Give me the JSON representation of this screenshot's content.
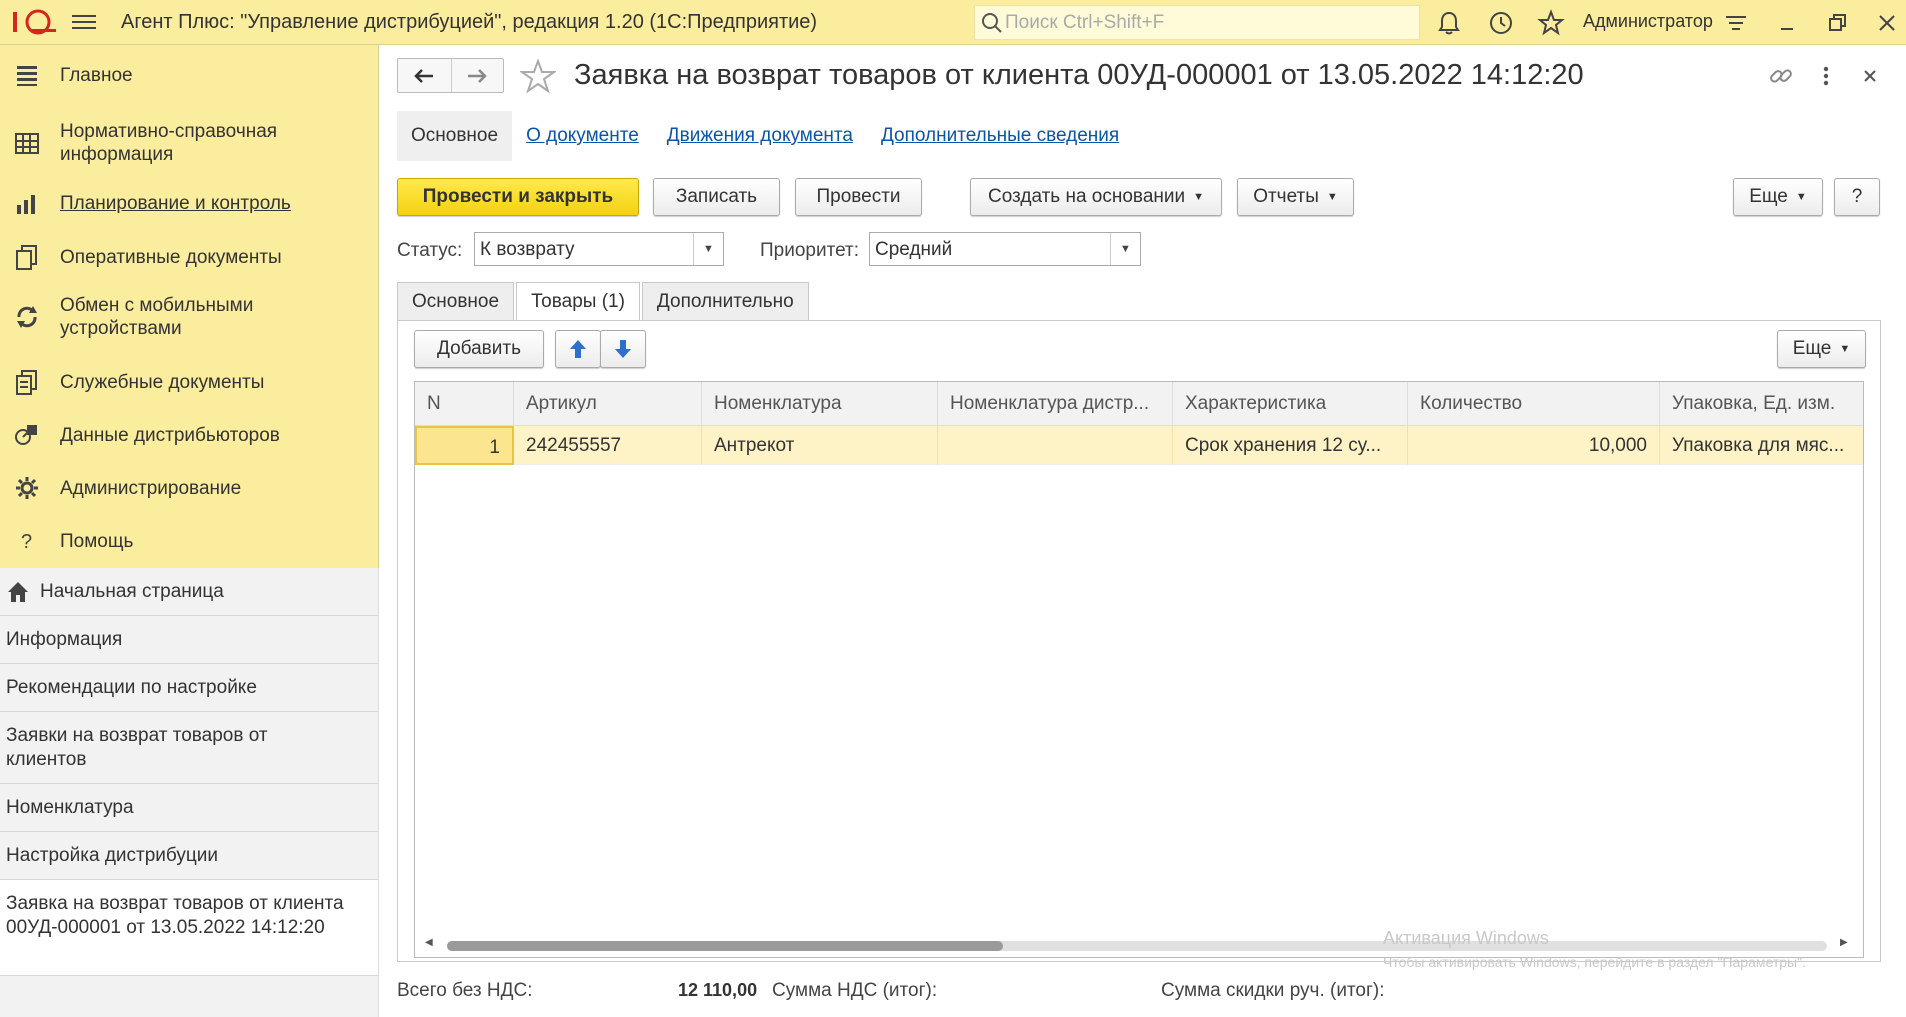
{
  "titlebar": {
    "logo_text": "1С",
    "app_title": "Агент Плюс: \"Управление дистрибуцией\", редакция 1.20  (1С:Предприятие)",
    "search_placeholder": "Поиск Ctrl+Shift+F",
    "user_name": "Администратор"
  },
  "sections": [
    {
      "label": "Главное",
      "icon": "menu-lines-icon",
      "active": false
    },
    {
      "label": "Нормативно-справочная информация",
      "icon": "grid-table-icon",
      "active": false
    },
    {
      "label": "Планирование и контроль",
      "icon": "bar-chart-icon",
      "active": true
    },
    {
      "label": "Оперативные документы",
      "icon": "documents-icon",
      "active": false
    },
    {
      "label": "Обмен с мобильными устройствами",
      "icon": "sync-icon",
      "active": false
    },
    {
      "label": "Служебные документы",
      "icon": "service-documents-icon",
      "active": false
    },
    {
      "label": "Данные дистрибьюторов",
      "icon": "distributor-data-icon",
      "active": false
    },
    {
      "label": "Администрирование",
      "icon": "gear-icon",
      "active": false
    },
    {
      "label": "Помощь",
      "icon": "question-icon",
      "active": false
    }
  ],
  "open_windows": [
    {
      "label": "Начальная страница",
      "home": true
    },
    {
      "label": "Информация"
    },
    {
      "label": "Рекомендации по настройке"
    },
    {
      "label": "Заявки на возврат товаров от клиентов"
    },
    {
      "label": "Номенклатура"
    },
    {
      "label": "Настройка дистрибуции"
    },
    {
      "label": "Заявка на возврат товаров от клиента 00УД-000001 от 13.05.2022 14:12:20",
      "current": true
    }
  ],
  "document": {
    "title": "Заявка на возврат товаров от клиента 00УД-000001 от 13.05.2022 14:12:20",
    "links": [
      {
        "label": "Основное",
        "active": true
      },
      {
        "label": "О документе"
      },
      {
        "label": "Движения документа"
      },
      {
        "label": "Дополнительные сведения"
      }
    ],
    "toolbar": {
      "post_close": "Провести и закрыть",
      "save": "Записать",
      "post": "Провести",
      "create_based": "Создать на основании",
      "reports": "Отчеты",
      "more": "Еще",
      "help": "?"
    },
    "status_label": "Статус:",
    "status_value": "К возврату",
    "priority_label": "Приоритет:",
    "priority_value": "Средний",
    "tabs": [
      {
        "label": "Основное"
      },
      {
        "label": "Товары (1)",
        "active": true
      },
      {
        "label": "Дополнительно"
      }
    ],
    "table_toolbar": {
      "add": "Добавить",
      "more": "Еще"
    },
    "table": {
      "columns": [
        "N",
        "Артикул",
        "Номенклатура",
        "Номенклатура дистр...",
        "Характеристика",
        "Количество",
        "Упаковка, Ед. изм."
      ],
      "rows": [
        [
          "1",
          "242455557",
          "Антрекот",
          "",
          "Срок хранения 12 су...",
          "10,000",
          "Упаковка для мяс..."
        ]
      ]
    },
    "watermark": {
      "line1": "Активация Windows",
      "line2": "Чтобы активировать Windows, перейдите в раздел \"Параметры\"."
    },
    "totals": {
      "total_no_vat_label": "Всего без НДС:",
      "total_no_vat_value": "12 110,00",
      "vat_label": "Сумма НДС (итог):",
      "discount_label": "Сумма скидки руч. (итог):"
    }
  }
}
